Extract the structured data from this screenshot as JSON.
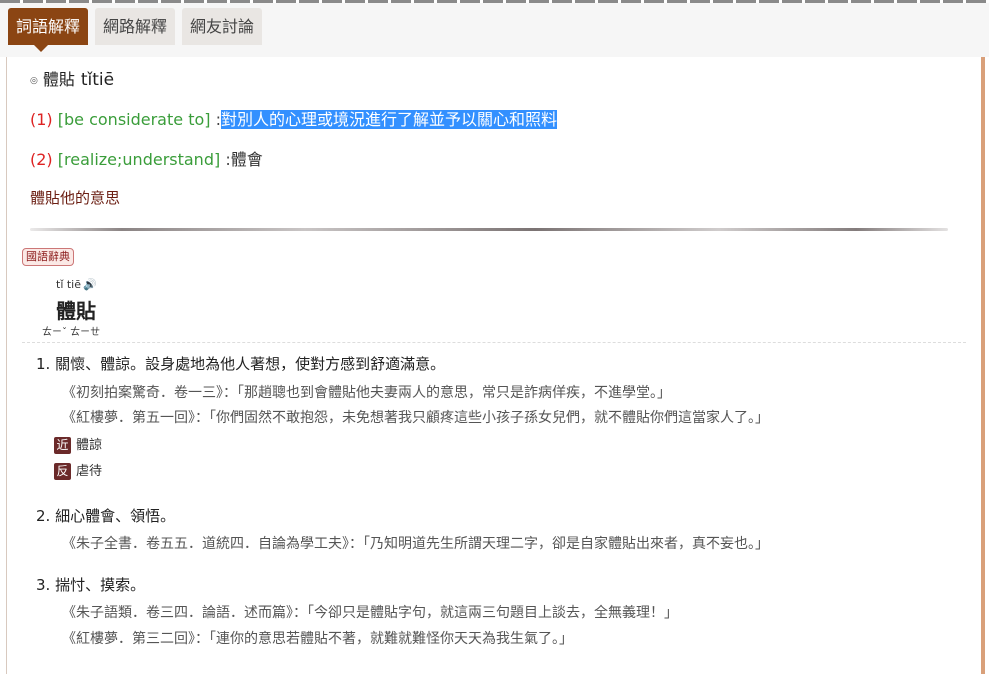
{
  "tabs": [
    "詞語解釋",
    "網路解釋",
    "網友討論"
  ],
  "entry": {
    "bullet": "◎",
    "word": "體貼",
    "pinyin": "tǐtiē"
  },
  "definitions": [
    {
      "num": "(1)",
      "en": "[be considerate to]",
      "sep": ":",
      "zh": "對別人的心理或境況進行了解並予以關心和照料"
    },
    {
      "num": "(2)",
      "en": "[realize;understand]",
      "sep": ":",
      "zh": "體會"
    }
  ],
  "sample": "體貼他的意思",
  "dict_badge": "國語辭典",
  "moedict": {
    "pinyin": "tǐ tiē",
    "speaker": "🔊",
    "word": "體貼",
    "zhuyin": "ㄊㄧˇ ㄊㄧㄝ",
    "senses": [
      {
        "text": "1. 關懷、體諒。設身處地為他人著想，使對方感到舒適滿意。",
        "quotes": [
          "《初刻拍案驚奇．卷一三》：「那趙聰也到會體貼他夫妻兩人的意思，常只是詐病佯疾，不進學堂。」",
          "《紅樓夢．第五一回》：「你們固然不敢抱怨，未免想著我只顧疼這些小孩子孫女兒們，就不體貼你們這當家人了。」"
        ],
        "synonym_tag": "近",
        "synonym": "體諒",
        "antonym_tag": "反",
        "antonym": "虐待"
      },
      {
        "text": "2. 細心體會、領悟。",
        "quotes": [
          "《朱子全書．卷五五．道統四．自論為學工夫》：「乃知明道先生所謂天理二字，卻是自家體貼出來者，真不妄也。」"
        ]
      },
      {
        "text": "3. 揣忖、摸索。",
        "quotes": [
          "《朱子語類．卷三四．論語．述而篇》：「今卻只是體貼字句，就這兩三句題目上談去，全無義理！」",
          "《紅樓夢．第三二回》：「連你的意思若體貼不著，就難就難怪你天天為我生氣了。」"
        ]
      }
    ]
  }
}
